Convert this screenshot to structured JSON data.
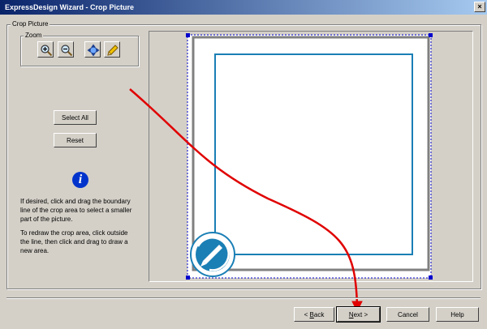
{
  "window": {
    "title": "ExpressDesign Wizard - Crop Picture",
    "close_label": "×"
  },
  "crop_group": {
    "label": "Crop Picture"
  },
  "zoom_group": {
    "label": "Zoom",
    "tools": [
      "zoom-in-icon",
      "zoom-out-icon",
      "pan-icon",
      "pencil-icon"
    ]
  },
  "buttons": {
    "select_all": "Select All",
    "reset": "Reset",
    "back_prefix": "< ",
    "back_mnemonic": "B",
    "back_rest": "ack",
    "next_mnemonic": "N",
    "next_rest": "ext >",
    "cancel": "Cancel",
    "help": "Help"
  },
  "info": {
    "icon": "info-icon",
    "glyph": "i",
    "paragraph1": "If desired, click and drag the boundary line of the crop area to select a smaller part of the picture.",
    "paragraph2": "To redraw the crop area, click outside the line, then click and drag to draw a new area."
  },
  "colors": {
    "crop_frame": "#1a7fb5",
    "arrow": "#e00000",
    "selection_handle": "#0000cc"
  }
}
